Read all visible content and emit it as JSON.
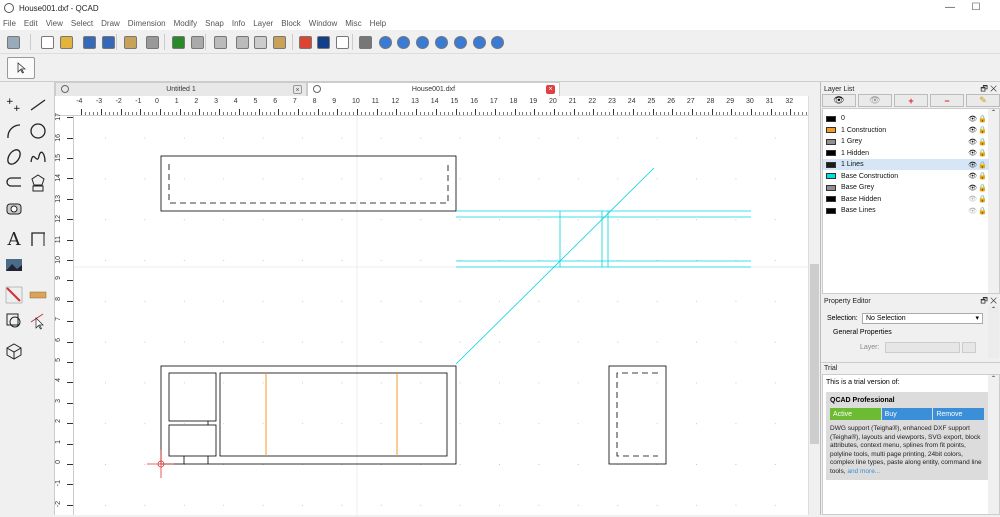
{
  "window": {
    "title": "House001.dxf - QCAD",
    "minimize": "—",
    "maximize": "☐"
  },
  "menu": [
    "File",
    "Edit",
    "View",
    "Select",
    "Draw",
    "Dimension",
    "Modify",
    "Snap",
    "Info",
    "Layer",
    "Block",
    "Window",
    "Misc",
    "Help"
  ],
  "toolbar": {
    "icons": [
      {
        "name": "select-tool-icon",
        "x": 4,
        "c": "#9ab"
      },
      {
        "name": "new-file-icon",
        "x": 38,
        "c": "#fff"
      },
      {
        "name": "open-file-icon",
        "x": 57,
        "c": "#e2b43c"
      },
      {
        "name": "save-icon",
        "x": 80,
        "c": "#3569b8"
      },
      {
        "name": "save-as-icon",
        "x": 99,
        "c": "#3569b8"
      },
      {
        "name": "print-preview-icon",
        "x": 121,
        "c": "#c9a25a"
      },
      {
        "name": "print-icon",
        "x": 143,
        "c": "#999"
      },
      {
        "name": "undo-icon",
        "x": 169,
        "c": "#2a8a2a"
      },
      {
        "name": "redo-icon",
        "x": 188,
        "c": "#aaa"
      },
      {
        "name": "pencil-icon",
        "x": 211,
        "c": "#bbb"
      },
      {
        "name": "cut-icon",
        "x": 233,
        "c": "#bbb"
      },
      {
        "name": "copy-icon",
        "x": 251,
        "c": "#ccc"
      },
      {
        "name": "paste-icon",
        "x": 270,
        "c": "#c9a25a"
      },
      {
        "name": "pen-icon",
        "x": 296,
        "c": "#d43"
      },
      {
        "name": "color-icon",
        "x": 314,
        "c": "#123e8a"
      },
      {
        "name": "linetype-icon",
        "x": 333,
        "c": "#fff"
      },
      {
        "name": "grid-icon",
        "x": 356,
        "c": "#777"
      },
      {
        "name": "zoom-in-icon",
        "x": 376,
        "c": "#3a7bd5"
      },
      {
        "name": "zoom-out-icon",
        "x": 394,
        "c": "#3a7bd5"
      },
      {
        "name": "zoom-auto-icon",
        "x": 413,
        "c": "#3a7bd5"
      },
      {
        "name": "zoom-selection-icon",
        "x": 432,
        "c": "#3a7bd5"
      },
      {
        "name": "zoom-previous-icon",
        "x": 451,
        "c": "#3a7bd5"
      },
      {
        "name": "zoom-window-icon",
        "x": 470,
        "c": "#3a7bd5"
      },
      {
        "name": "zoom-pan-icon",
        "x": 488,
        "c": "#3a7bd5"
      }
    ]
  },
  "tabs": [
    {
      "label": "Untitled 1",
      "close": "×",
      "active": false
    },
    {
      "label": "House001.dxf",
      "close": "×",
      "active": true
    }
  ],
  "ruler": {
    "x_ticks": [
      "-4",
      "-3",
      "-2",
      "-1",
      "0",
      "1",
      "2",
      "3",
      "4",
      "5",
      "6",
      "7",
      "8",
      "9",
      "10",
      "11",
      "12",
      "13",
      "14",
      "15",
      "16",
      "17",
      "18",
      "19",
      "20",
      "21",
      "22",
      "23",
      "24",
      "25",
      "26",
      "27",
      "28",
      "29",
      "30",
      "31",
      "32"
    ],
    "y_ticks": [
      "17",
      "16",
      "15",
      "14",
      "13",
      "12",
      "11",
      "10",
      "9",
      "8",
      "7",
      "6",
      "5",
      "4",
      "3",
      "2",
      "1",
      "0",
      "-1",
      "-2"
    ]
  },
  "layer_panel": {
    "title": "Layer List",
    "buttons": [
      "👁",
      "👁",
      "+",
      "−",
      "✎"
    ],
    "layers": [
      {
        "name": "0",
        "color": "#000000",
        "visible": true,
        "selected": false
      },
      {
        "name": "1 Construction",
        "color": "#f39b28",
        "visible": true,
        "selected": false
      },
      {
        "name": "1 Grey",
        "color": "#909090",
        "visible": true,
        "selected": false
      },
      {
        "name": "1 Hidden",
        "color": "#000000",
        "visible": true,
        "selected": false
      },
      {
        "name": "1 Lines",
        "color": "#1a1a1a",
        "visible": true,
        "selected": true
      },
      {
        "name": "Base Construction",
        "color": "#00e0e0",
        "visible": true,
        "selected": false
      },
      {
        "name": "Base Grey",
        "color": "#909090",
        "visible": true,
        "selected": false
      },
      {
        "name": "Base Hidden",
        "color": "#000000",
        "visible": false,
        "selected": false
      },
      {
        "name": "Base Lines",
        "color": "#000000",
        "visible": false,
        "selected": false
      }
    ]
  },
  "property_editor": {
    "title": "Property Editor",
    "selection_label": "Selection:",
    "selection_value": "No Selection",
    "section": "General Properties",
    "layer_label": "Layer:"
  },
  "trial": {
    "title": "Trial",
    "intro": "This is a trial version of:",
    "product": "QCAD Professional",
    "buttons": [
      {
        "label": "Active",
        "color": "#6cbb32"
      },
      {
        "label": "Buy",
        "color": "#3a8fd8"
      },
      {
        "label": "Remove",
        "color": "#3a8fd8"
      }
    ],
    "description": "DWG support (Teigha®), enhanced DXF support (Teigha®), layouts and viewports, SVG export, block attributes, context menu, splines from fit points, polyline tools, multi page printing, 24bit colors, complex line types, paste along entity, command line tools,",
    "more_link": "and more..."
  },
  "colors": {
    "construction": "#00d4e0",
    "orange": "#f39b28",
    "grid": "#c8c8c8",
    "origin": "#d33"
  }
}
